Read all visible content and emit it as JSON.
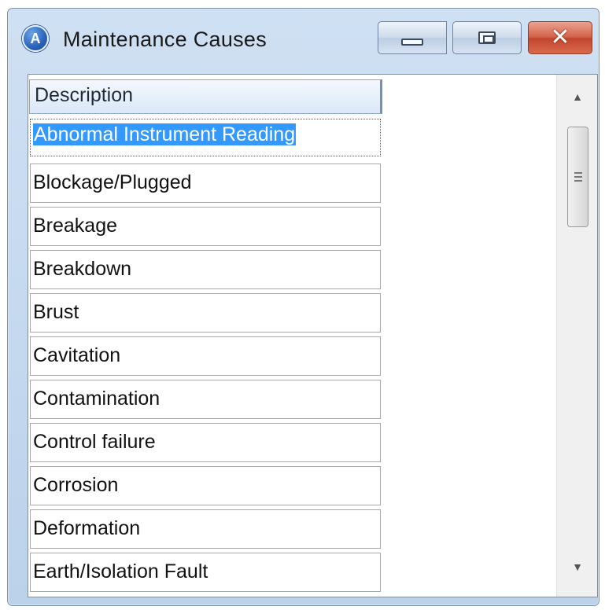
{
  "window": {
    "title": "Maintenance Causes",
    "icon": "app-icon-A",
    "icon_letter": "A",
    "controls": {
      "minimize": "minimize-icon",
      "maximize": "maximize-icon",
      "close": "close-icon",
      "close_glyph": "✕"
    }
  },
  "grid": {
    "header": "Description",
    "rows": [
      "Abnormal Instrument Reading",
      "Blockage/Plugged",
      "Breakage",
      "Breakdown",
      "Brust",
      "Cavitation",
      "Contamination",
      "Control failure",
      "Corrosion",
      "Deformation",
      "Earth/Isolation Fault"
    ],
    "selected_index": 0
  },
  "scrollbar": {
    "up_arrow": "▲",
    "down_arrow": "▼"
  },
  "colors": {
    "selection": "#3399ff",
    "close_button": "#c94a32",
    "frame": "#bcd2eb"
  }
}
